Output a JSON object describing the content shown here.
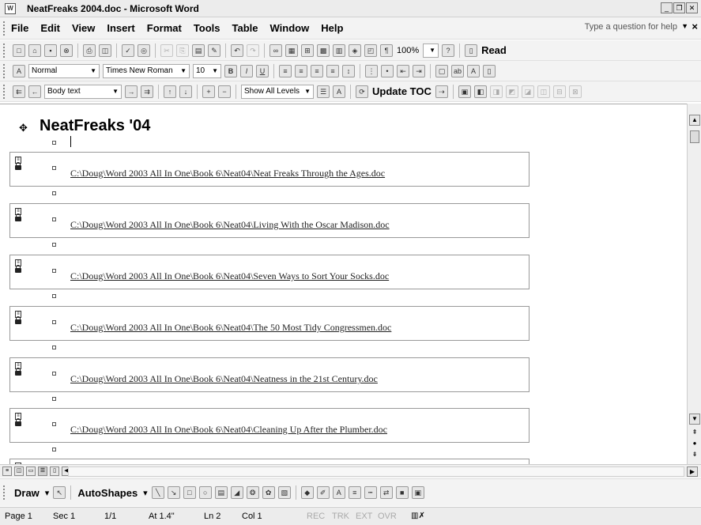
{
  "window": {
    "title": "NeatFreaks 2004.doc - Microsoft Word"
  },
  "menu": {
    "items": [
      "File",
      "Edit",
      "View",
      "Insert",
      "Format",
      "Tools",
      "Table",
      "Window",
      "Help"
    ],
    "help_placeholder": "Type a question for help"
  },
  "standard_toolbar": {
    "zoom": "100%",
    "read_label": "Read"
  },
  "formatting_toolbar": {
    "style": "Normal",
    "font": "Times New Roman",
    "size": "10"
  },
  "outlining_toolbar": {
    "level": "Body text",
    "show_levels": "Show All Levels",
    "update_toc": "Update TOC"
  },
  "document": {
    "heading": "NeatFreaks '04",
    "subdocuments": [
      "C:\\Doug\\Word 2003 All In One\\Book 6\\Neat04\\Neat Freaks Through the Ages.doc",
      "C:\\Doug\\Word 2003 All In One\\Book 6\\Neat04\\Living With the Oscar Madison.doc",
      "C:\\Doug\\Word 2003 All In One\\Book 6\\Neat04\\Seven Ways to Sort Your Socks.doc",
      "C:\\Doug\\Word 2003 All In One\\Book 6\\Neat04\\The 50 Most Tidy Congressmen.doc",
      "C:\\Doug\\Word 2003 All In One\\Book 6\\Neat04\\Neatness in the 21st Century.doc",
      "C:\\Doug\\Word 2003 All In One\\Book 6\\Neat04\\Cleaning Up After the Plumber.doc"
    ]
  },
  "drawing_toolbar": {
    "draw": "Draw",
    "autoshapes": "AutoShapes"
  },
  "status": {
    "page": "Page 1",
    "sec": "Sec 1",
    "pages": "1/1",
    "at": "At 1.4\"",
    "ln": "Ln 2",
    "col": "Col 1",
    "rec": "REC",
    "trk": "TRK",
    "ext": "EXT",
    "ovr": "OVR"
  }
}
